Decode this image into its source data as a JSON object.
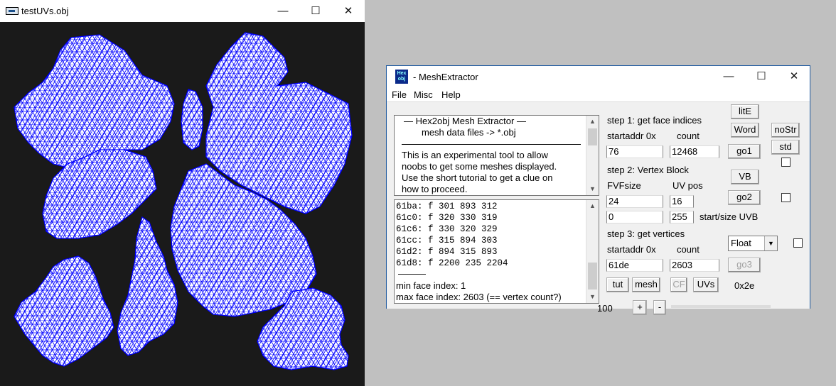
{
  "viewer": {
    "title": "testUVs.obj",
    "mesh_color": "#0000ff",
    "background_color": "#1a1a1a"
  },
  "app": {
    "title": "- MeshExtractor",
    "icon_text_1": "Hex",
    "icon_text_2": "obj",
    "menu": [
      "File",
      "Misc",
      "Help"
    ],
    "info": {
      "line1": "—   Hex2obj Mesh Extractor   —",
      "line2": "mesh data files -> *.obj",
      "body": [
        "This is an experimental tool to allow",
        "noobs to get some meshes displayed.",
        "Use the short tutorial to get a clue on",
        "how to proceed."
      ]
    },
    "log": {
      "lines": [
        "61ba: f  301 893 312",
        "61c0: f  320 330 319",
        "61c6: f  330 320 329",
        "61cc: f  315 894 303",
        "61d2: f  894 315 893",
        "61d8: f  2200 235 2204"
      ],
      "separator": "———",
      "min": "min face index: 1",
      "max": "max face index: 2603 (== vertex count?)"
    },
    "step1": {
      "title": "step 1: get face indices",
      "startaddr_label": "startaddr 0x",
      "count_label": "count",
      "startaddr": "76",
      "count": "12468"
    },
    "step2": {
      "title": "step 2: Vertex Block",
      "fvf_label": "FVFsize",
      "uvpos_label": "UV pos",
      "fvfsize": "24",
      "uvpos": "16",
      "uvb_start": "0",
      "uvb_size": "255",
      "uvb_label": "start/size UVB"
    },
    "step3": {
      "title": "step 3: get vertices",
      "startaddr_label": "startaddr 0x",
      "count_label": "count",
      "startaddr": "61de",
      "count": "2603",
      "format": "Float"
    },
    "buttons": {
      "lite": "litE",
      "word": "Word",
      "nostr": "noStr",
      "std": "std",
      "go1": "go1",
      "vb": "VB",
      "go2": "go2",
      "go3": "go3",
      "tut": "tut",
      "mesh": "mesh",
      "cf": "CF",
      "uvs": "UVs",
      "plus": "+",
      "minus": "-"
    },
    "hex_readout": "0x2e",
    "zoom_value": "100"
  }
}
